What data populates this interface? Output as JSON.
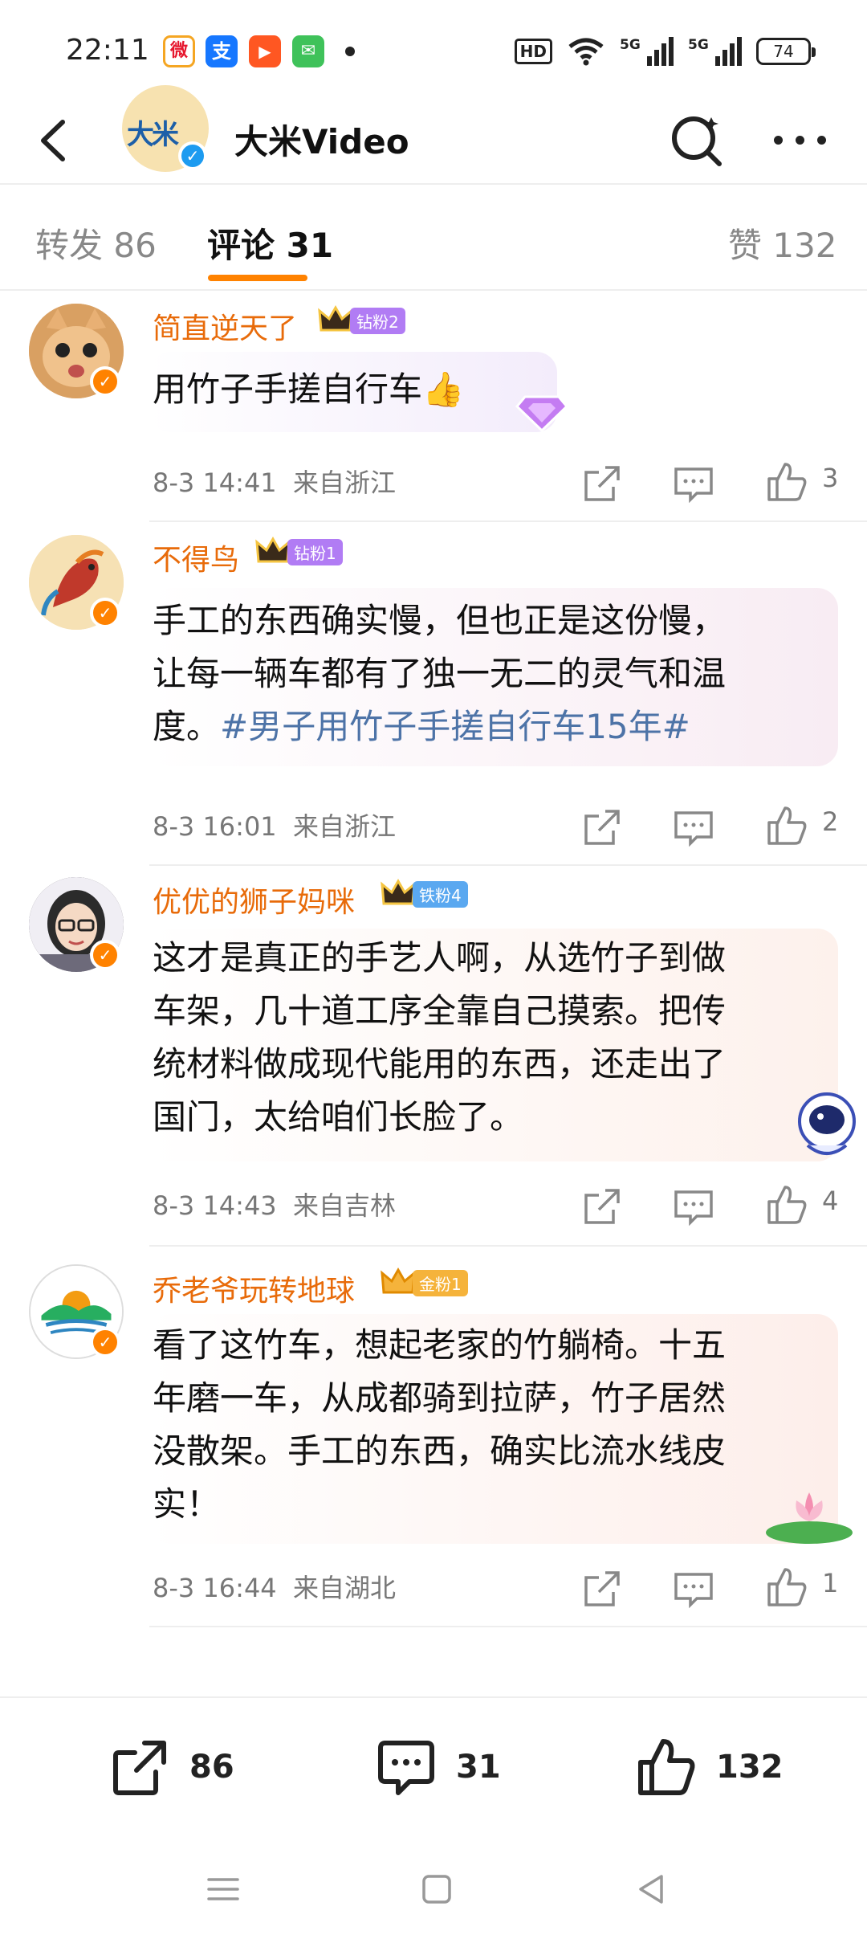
{
  "status_bar": {
    "time": "22:11",
    "apps": [
      {
        "icon": "weibo-app-icon",
        "glyph": "微",
        "color": "#e6162d"
      },
      {
        "icon": "alipay-app-icon",
        "glyph": "支",
        "color": "#1677ff"
      },
      {
        "icon": "video-app-icon",
        "glyph": "▶",
        "color": "#ff5722"
      },
      {
        "icon": "message-app-icon",
        "glyph": "✉",
        "color": "#3fc25a"
      }
    ],
    "hd": "HD",
    "net1": "5G",
    "net2": "5G",
    "battery": "74"
  },
  "header": {
    "title": "大米Video",
    "avatar_text": "大米"
  },
  "tabs": {
    "repost": "转发 86",
    "comment": "评论 31",
    "likes": "赞 132"
  },
  "comments": [
    {
      "name": "简直逆天了",
      "fan_level": "钻粉2",
      "fan_color": "#b17cf4",
      "lines": [
        "用竹子手搓自行车👍"
      ],
      "time": "8-3 14:41",
      "location": "来自浙江",
      "likes": "3",
      "avatar_bg": "#e8b074"
    },
    {
      "name": "不得鸟",
      "fan_level": "钻粉1",
      "fan_color": "#b17cf4",
      "lines": [
        "手工的东西确实慢，但也正是这份慢，",
        "让每一辆车都有了独一无二的灵气和温"
      ],
      "last_line_plain": "度。",
      "hashtag": "#男子用竹子手搓自行车15年#",
      "time": "8-3 16:01",
      "location": "来自浙江",
      "likes": "2",
      "avatar_bg": "#f3dcae"
    },
    {
      "name": "优优的狮子妈咪",
      "fan_level": "铁粉4",
      "fan_color": "#5aa8f0",
      "lines": [
        "这才是真正的手艺人啊，从选竹子到做",
        "车架，几十道工序全靠自己摸索。把传",
        "统材料做成现代能用的东西，还走出了",
        "国门，太给咱们长脸了。"
      ],
      "time": "8-3 14:43",
      "location": "来自吉林",
      "likes": "4",
      "avatar_bg": "#3a3340"
    },
    {
      "name": "乔老爷玩转地球",
      "fan_level": "金粉1",
      "fan_color": "#f5b33b",
      "lines": [
        "看了这竹车，想起老家的竹躺椅。十五",
        "年磨一车，从成都骑到拉萨，竹子居然",
        "没散架。手工的东西，确实比流水线皮",
        "实！"
      ],
      "time": "8-3 16:44",
      "location": "来自湖北",
      "likes": "1",
      "avatar_bg": "#ffffff"
    }
  ],
  "bottom_bar": {
    "repost_count": "86",
    "comment_count": "31",
    "like_count": "132"
  }
}
